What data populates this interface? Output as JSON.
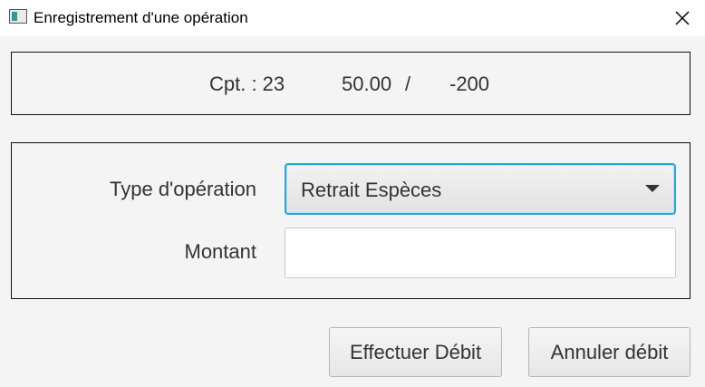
{
  "window": {
    "title": "Enregistrement d'une opération",
    "close_glyph": "✕"
  },
  "account_info": {
    "account": "Cpt. : 23",
    "balance": "50.00",
    "separator": "/",
    "overdraft": "-200"
  },
  "form": {
    "operation_type_label": "Type d'opération",
    "operation_type_value": "Retrait Espèces",
    "amount_label": "Montant",
    "amount_value": "",
    "amount_placeholder": ""
  },
  "buttons": {
    "debit_label": "Effectuer Débit",
    "cancel_label": "Annuler débit"
  },
  "icons": {
    "app": "window-icon",
    "close": "close-icon",
    "dropdown": "chevron-down-icon"
  },
  "colors": {
    "focus_border": "#2aa3d8",
    "icon_accent": "#2c9a96"
  }
}
